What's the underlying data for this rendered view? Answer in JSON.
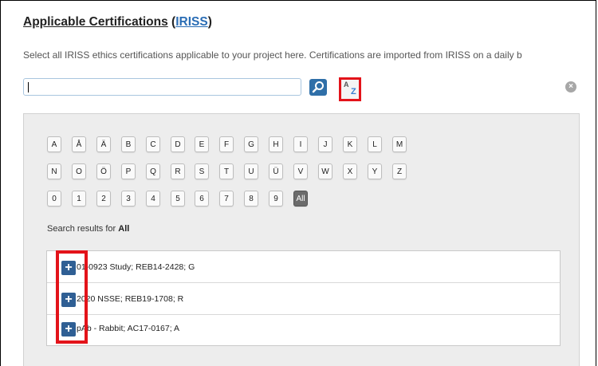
{
  "header": {
    "title": "Applicable Certifications",
    "title_open": " (",
    "title_link": "IRISS",
    "title_close": ")",
    "description": "Select all IRISS ethics certifications applicable to your project here. Certifications are imported from IRISS on a daily b"
  },
  "search": {
    "value": "",
    "search_icon": "magnifier-icon",
    "az_letters": [
      "A",
      "Z"
    ],
    "clear_symbol": "×"
  },
  "letters": {
    "row1": [
      "A",
      "Å",
      "Ä",
      "B",
      "C",
      "D",
      "E",
      "F",
      "G",
      "H",
      "I",
      "J",
      "K",
      "L",
      "M"
    ],
    "row2": [
      "N",
      "O",
      "Ö",
      "P",
      "Q",
      "R",
      "S",
      "T",
      "U",
      "Ü",
      "V",
      "W",
      "X",
      "Y",
      "Z"
    ],
    "row3": [
      "0",
      "1",
      "2",
      "3",
      "4",
      "5",
      "6",
      "7",
      "8",
      "9",
      "All"
    ],
    "selected": "All"
  },
  "results": {
    "label_prefix": "Search results for ",
    "label_term": "All",
    "items": [
      {
        "add_symbol": "+",
        "text": "01-0923 Study; REB14-2428; G"
      },
      {
        "add_symbol": "+",
        "text": "2020 NSSE; REB19-1708; R"
      },
      {
        "add_symbol": "+",
        "text": "pAb - Rabbit; AC17-0167; A"
      }
    ]
  },
  "colors": {
    "highlight": "#e3131a",
    "accent": "#2f6fa8",
    "link": "#2a6db5"
  }
}
